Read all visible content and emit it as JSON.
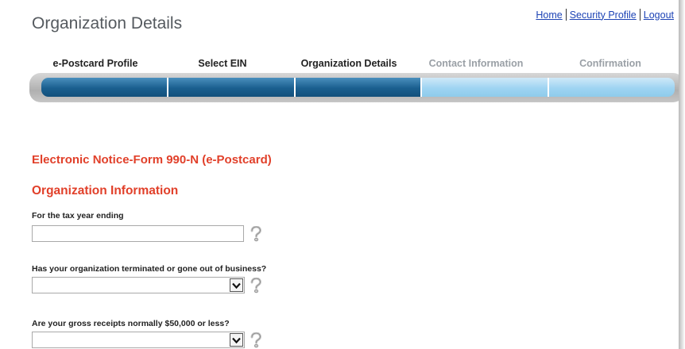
{
  "page": {
    "title": "Organization Details"
  },
  "top_links": {
    "home": "Home",
    "security_profile": "Security Profile",
    "logout": "Logout"
  },
  "steps": [
    {
      "label": "e-Postcard Profile",
      "status": "complete"
    },
    {
      "label": "Select EIN",
      "status": "complete"
    },
    {
      "label": "Organization Details",
      "status": "current"
    },
    {
      "label": "Contact Information",
      "status": "upcoming"
    },
    {
      "label": "Confirmation",
      "status": "upcoming"
    }
  ],
  "sections": {
    "notice_title": "Electronic Notice-Form 990-N (e-Postcard)",
    "org_info_title": "Organization Information"
  },
  "form": {
    "tax_year": {
      "label": "For the tax year ending",
      "value": ""
    },
    "terminated": {
      "label": "Has your organization terminated or gone out of business?",
      "value": ""
    },
    "gross_receipts": {
      "label": "Are your gross receipts normally $50,000 or less?",
      "value": ""
    }
  },
  "colors": {
    "heading_red": "#e1402a",
    "link_blue": "#1d43b5",
    "progress_complete": "#1a5f8f",
    "progress_upcoming": "#9fd4f2",
    "title_gray": "#555a5f"
  }
}
